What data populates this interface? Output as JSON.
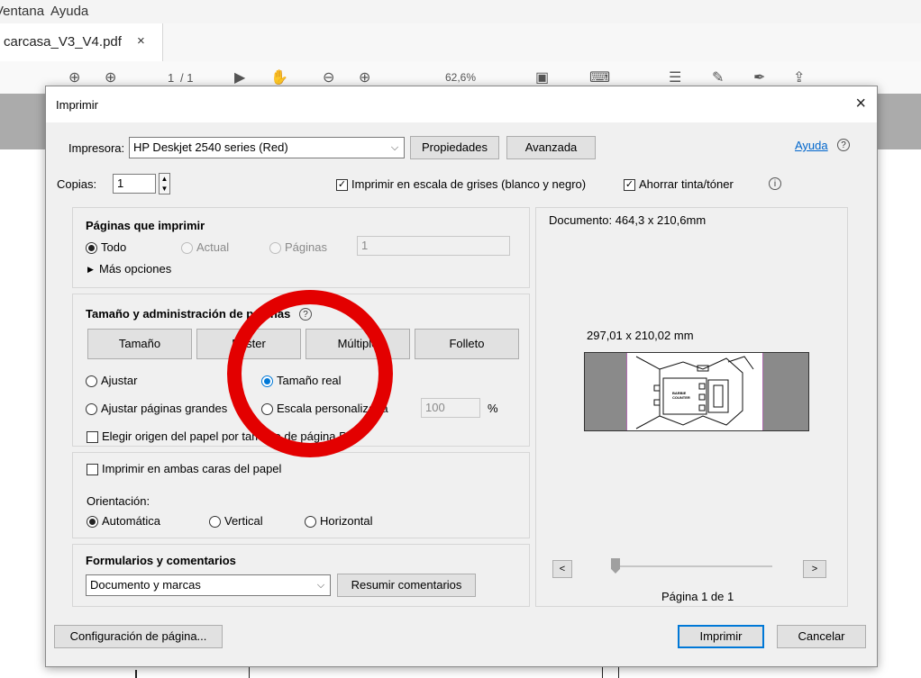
{
  "app": {
    "menu_items": [
      "Ventana",
      "Ayuda"
    ],
    "doc_tab_name": "carcasa_V3_V4.pdf",
    "doc_tab_close": "×",
    "page_current": "1",
    "page_total": "/ 1",
    "zoom": "62,6%"
  },
  "dialog": {
    "title": "Imprimir",
    "close": "×",
    "printer_label": "Impresora:",
    "printer_value": "HP Deskjet 2540 series (Red)",
    "properties_button": "Propiedades",
    "advanced_button": "Avanzada",
    "help_link": "Ayuda",
    "copies_label": "Copias:",
    "copies_value": "1",
    "grayscale_label": "Imprimir en escala de grises (blanco y negro)",
    "save_ink_label": "Ahorrar tinta/tóner",
    "pages": {
      "title": "Páginas que imprimir",
      "all": "Todo",
      "current": "Actual",
      "pages": "Páginas",
      "pages_value": "1",
      "more_options": "Más opciones"
    },
    "sizing": {
      "title": "Tamaño y administración de páginas",
      "size_button": "Tamaño",
      "poster_button": "Póster",
      "multiple_button": "Múltiple",
      "booklet_button": "Folleto",
      "fit": "Ajustar",
      "actual_size": "Tamaño real",
      "shrink": "Ajustar páginas grandes",
      "custom_scale": "Escala personalizada",
      "scale_value": "100",
      "percent": "%",
      "choose_source": "Elegir origen del papel por tamaño de página PDF"
    },
    "duplex_label": "Imprimir en ambas caras del papel",
    "orientation": {
      "title": "Orientación:",
      "auto": "Automática",
      "portrait": "Vertical",
      "landscape": "Horizontal"
    },
    "forms": {
      "title": "Formularios y comentarios",
      "value": "Documento y marcas",
      "summarize_button": "Resumir comentarios"
    },
    "preview": {
      "document_size": "Documento: 464,3 x 210,6mm",
      "paper_size": "297,01 x 210,02 mm",
      "page_label": "Página 1 de 1",
      "prev": "<",
      "next": ">",
      "thumb_text": "BARBIE\nCOUNTER"
    },
    "page_setup_button": "Configuración de página...",
    "print_button": "Imprimir",
    "cancel_button": "Cancelar"
  },
  "colors": {
    "annotation_circle": "#e30000",
    "accent": "#0078d7",
    "link": "#0066cc"
  }
}
